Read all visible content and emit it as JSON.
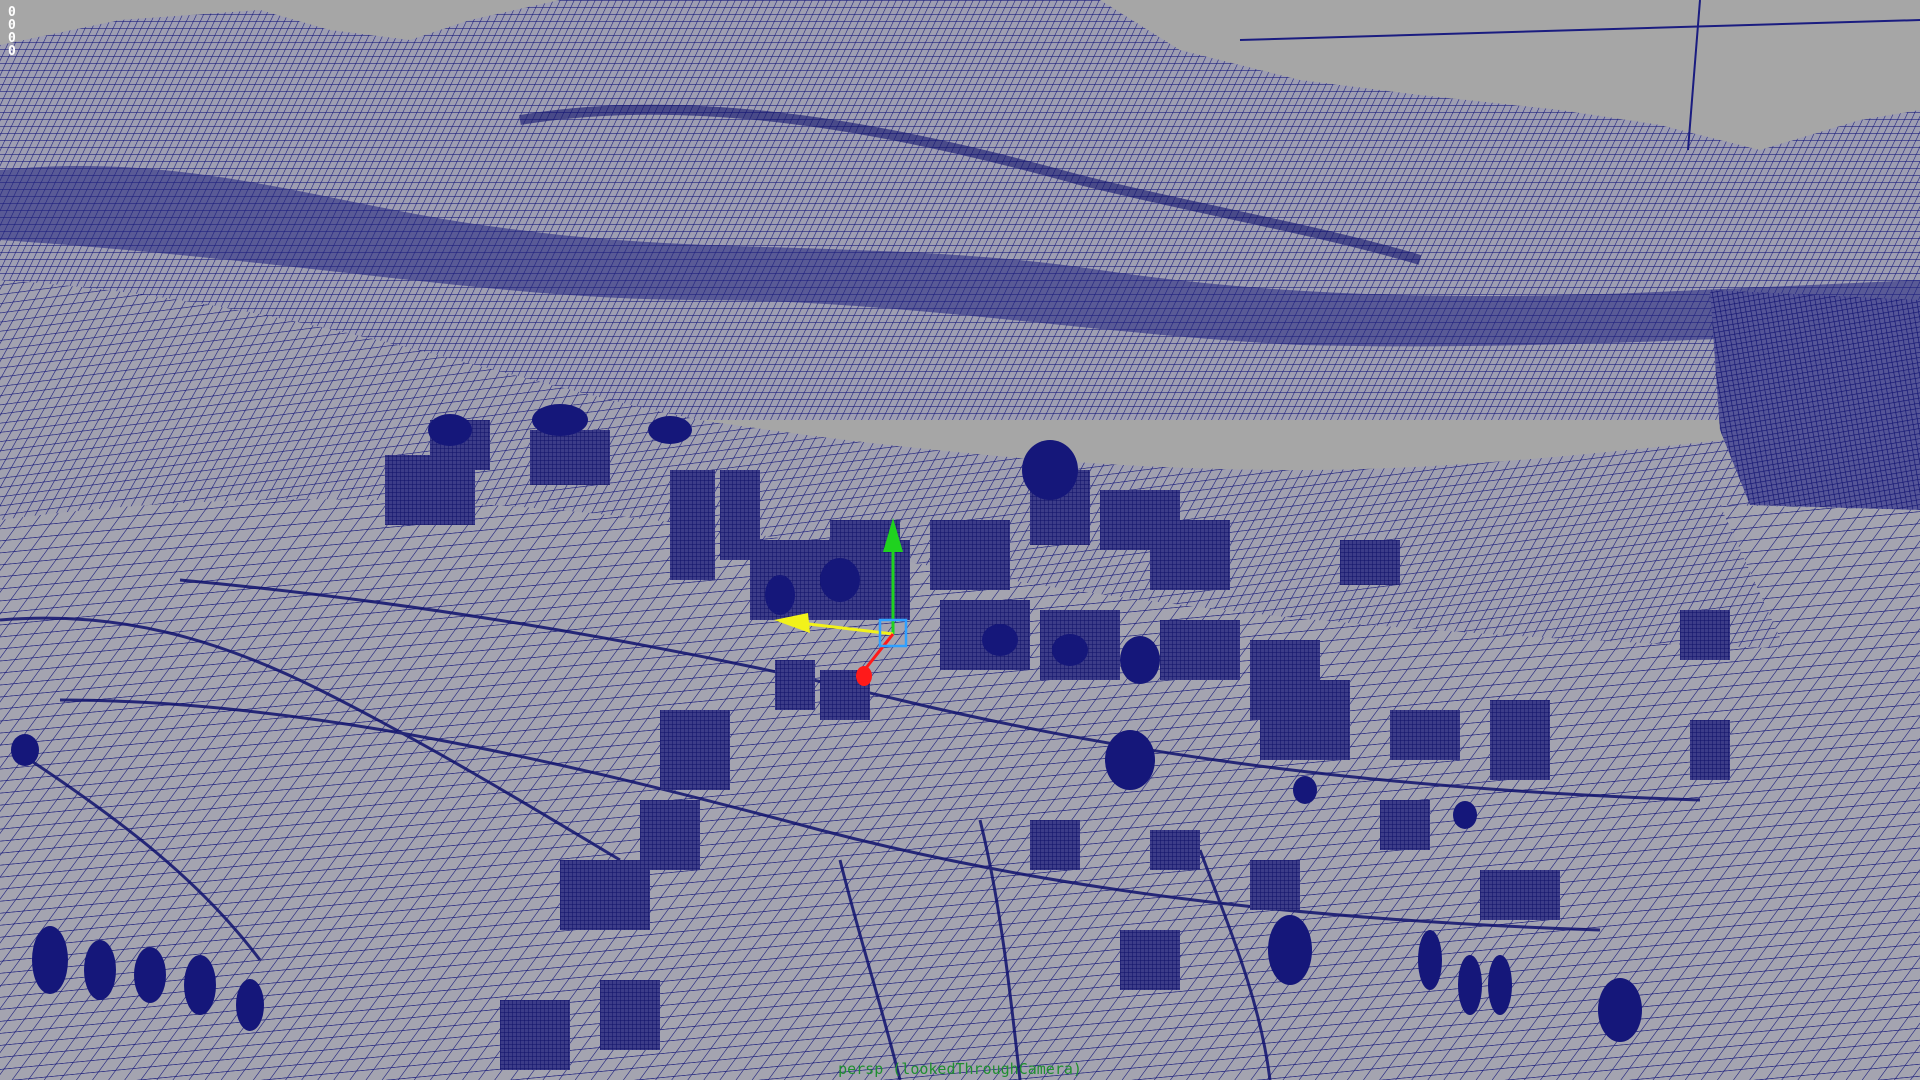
{
  "app": "3D modeling viewport",
  "viewport": {
    "camera_name": "persp (lookedThroughCamera)",
    "readout_values": [
      "0",
      "0",
      "0",
      "0"
    ],
    "colors": {
      "background": "#a6a6a6",
      "wireframe": "#14167a",
      "manip_y": "#1fd21f",
      "manip_x": "#ff1a1a",
      "manip_z": "#f2f21a",
      "manip_center": "#2fa0ff"
    }
  },
  "scene_objects": {
    "terrain": "wireframe terrain mesh",
    "buildings": "wireframe buildings",
    "trees": "wireframe trees"
  },
  "icons": {
    "manipulator": "move-manipulator-icon"
  }
}
